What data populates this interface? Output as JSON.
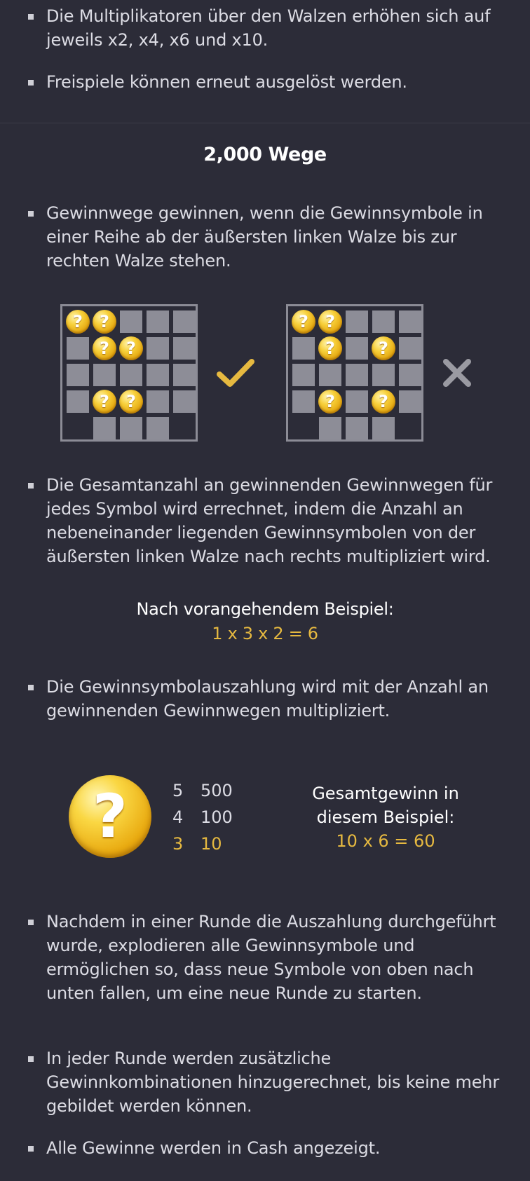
{
  "top_bullets": [
    "Die Multiplikatoren über den Walzen erhöhen sich auf jeweils x2, x4, x6 und x10.",
    "Freispiele können erneut ausgelöst werden."
  ],
  "ways_section": {
    "title": "2,000 Wege",
    "bullet_1": "Gewinnwege gewinnen, wenn die Gewinnsymbole in einer Reihe ab der äußersten linken Walze bis zur rechten Walze stehen.",
    "bullet_2": "Die Gesamtanzahl an gewinnenden Gewinnwegen für jedes Symbol wird errechnet, indem die Anzahl an nebeneinander liegenden Gewinnsymbolen von der äußersten linken Walze nach rechts multipliziert wird.",
    "example_label": "Nach vorangehendem Beispiel:",
    "example_formula": "1 x 3 x 2 = 6",
    "bullet_3": "Die Gewinnsymbolauszahlung wird mit der Anzahl an gewinnenden Gewinnwegen multipliziert.",
    "valid_icon": "check-icon",
    "invalid_icon": "cross-icon"
  },
  "symbol_glyph": "?",
  "paytable": [
    {
      "count": "5",
      "payout": "500",
      "highlight": false
    },
    {
      "count": "4",
      "payout": "100",
      "highlight": false
    },
    {
      "count": "3",
      "payout": "10",
      "highlight": true
    }
  ],
  "result": {
    "label_line1": "Gesamtgewinn in",
    "label_line2": "diesem Beispiel:",
    "formula": "10 x 6 = 60"
  },
  "bottom_bullets": [
    "Nachdem in einer Runde die Auszahlung durchgeführt wurde, explodieren alle Gewinnsymbole und ermöglichen so, dass neue Symbole von oben nach unten fallen, um eine neue Runde zu starten.",
    "In jeder Runde werden zusätzliche Gewinnkombinationen hinzugerechnet, bis keine mehr gebildet werden können.",
    "Alle Gewinne werden in Cash angezeigt."
  ],
  "colors": {
    "background": "#2c2c38",
    "text": "#dcdce4",
    "accent_gold": "#e6b940",
    "grid_cell": "#8d8d97"
  }
}
